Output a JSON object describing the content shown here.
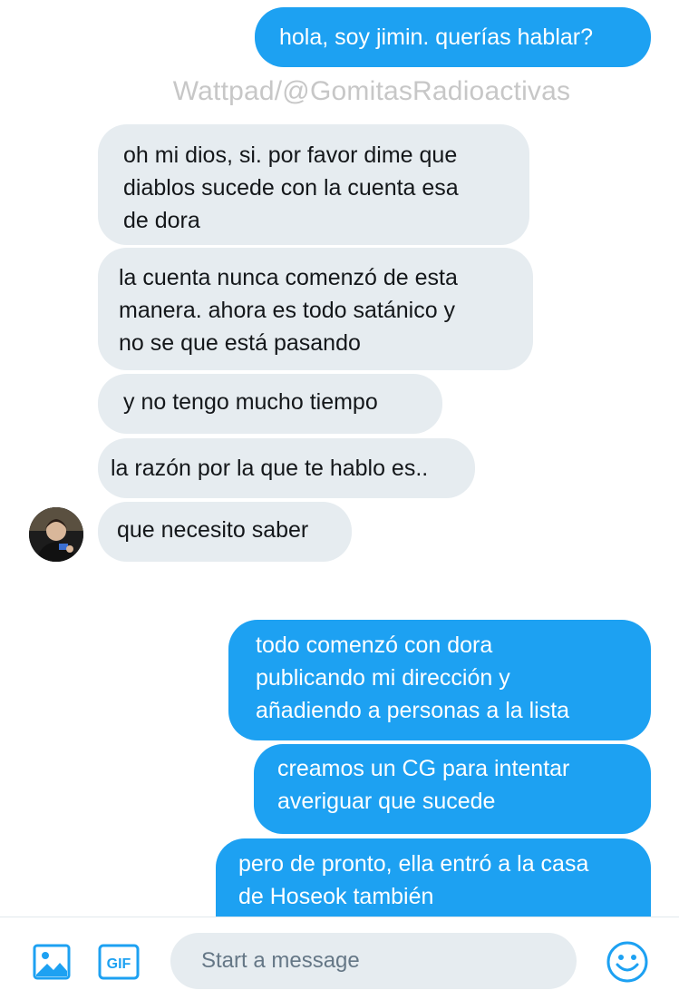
{
  "colors": {
    "outgoing_bubble": "#1da1f2",
    "incoming_bubble": "#e6ecf0",
    "accent": "#1da1f2",
    "watermark": "#c7c7c7"
  },
  "watermark": "Wattpad/@GomitasRadioactivas",
  "messages": [
    {
      "direction": "outgoing",
      "text": "hola, soy jimin. querías hablar?"
    },
    {
      "direction": "incoming",
      "text": "oh mi dios, si. por favor dime que\ndiablos sucede con la cuenta esa\nde dora"
    },
    {
      "direction": "incoming",
      "text": "la cuenta nunca comenzó de esta\nmanera. ahora es todo satánico y\nno se que está pasando"
    },
    {
      "direction": "incoming",
      "text": "y no tengo mucho tiempo"
    },
    {
      "direction": "incoming",
      "text": "la razón por la que te hablo es.."
    },
    {
      "direction": "incoming",
      "text": "que necesito saber"
    },
    {
      "direction": "outgoing",
      "text": "todo comenzó con dora\npublicando mi dirección y\nañadiendo a personas a la lista"
    },
    {
      "direction": "outgoing",
      "text": "creamos un CG para intentar\naveriguar que sucede"
    },
    {
      "direction": "outgoing",
      "text": "pero de pronto, ella entró a la casa\nde Hoseok también"
    }
  ],
  "composer": {
    "placeholder": "Start a message",
    "value": "",
    "image_icon": "image-icon",
    "gif_icon": "gif-icon",
    "gif_label": "GIF",
    "emoji_icon": "emoji-icon"
  }
}
